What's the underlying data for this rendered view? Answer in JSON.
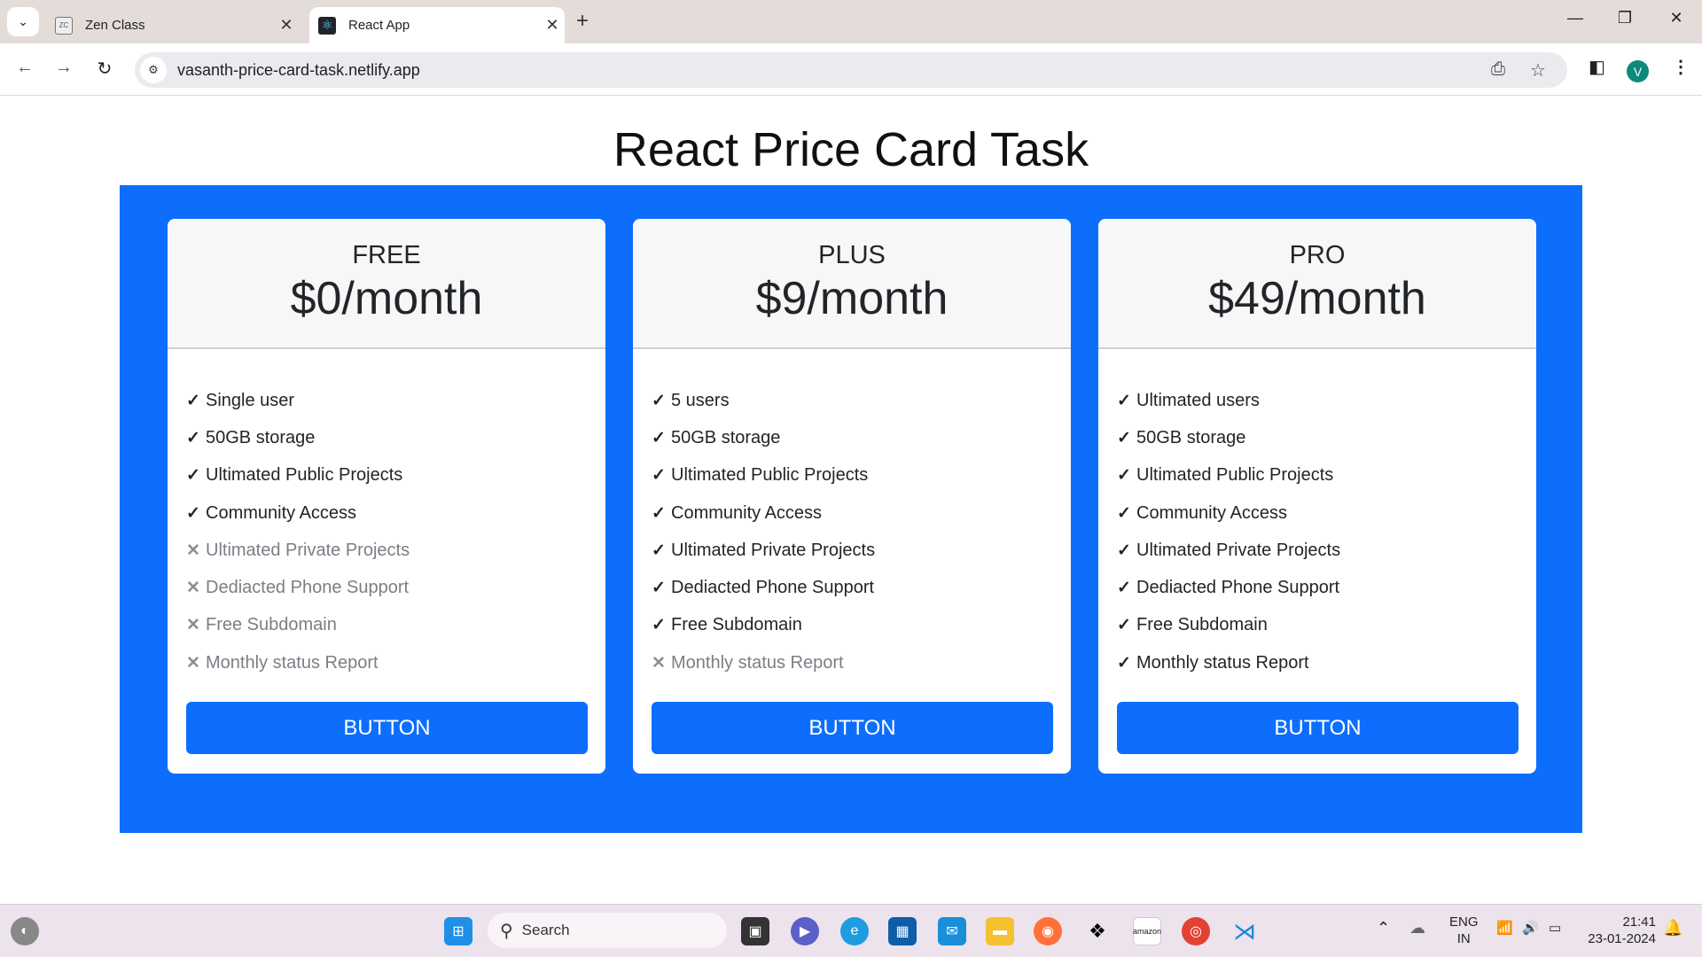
{
  "browser": {
    "tabs": [
      {
        "title": "Zen Class",
        "favicon": "zen-class-icon",
        "active": false
      },
      {
        "title": "React App",
        "favicon": "react-icon",
        "active": true
      }
    ],
    "url": "vasanth-price-card-task.netlify.app",
    "profile_initial": "V"
  },
  "page": {
    "title": "React Price Card Task",
    "accent_color": "#0d6efd",
    "cards": [
      {
        "plan": "FREE",
        "price": "$0/month",
        "button": "BUTTON",
        "features": [
          {
            "text": "Single user",
            "included": true
          },
          {
            "text": "50GB storage",
            "included": true
          },
          {
            "text": "Ultimated Public Projects",
            "included": true
          },
          {
            "text": "Community Access",
            "included": true
          },
          {
            "text": "Ultimated Private Projects",
            "included": false
          },
          {
            "text": "Dediacted Phone Support",
            "included": false
          },
          {
            "text": "Free Subdomain",
            "included": false
          },
          {
            "text": "Monthly status Report",
            "included": false
          }
        ]
      },
      {
        "plan": "PLUS",
        "price": "$9/month",
        "button": "BUTTON",
        "features": [
          {
            "text": "5 users",
            "included": true
          },
          {
            "text": "50GB storage",
            "included": true
          },
          {
            "text": "Ultimated Public Projects",
            "included": true
          },
          {
            "text": "Community Access",
            "included": true
          },
          {
            "text": "Ultimated Private Projects",
            "included": true
          },
          {
            "text": "Dediacted Phone Support",
            "included": true
          },
          {
            "text": "Free Subdomain",
            "included": true
          },
          {
            "text": "Monthly status Report",
            "included": false
          }
        ]
      },
      {
        "plan": "PRO",
        "price": "$49/month",
        "button": "BUTTON",
        "features": [
          {
            "text": "Ultimated users",
            "included": true
          },
          {
            "text": "50GB storage",
            "included": true
          },
          {
            "text": "Ultimated Public Projects",
            "included": true
          },
          {
            "text": "Community Access",
            "included": true
          },
          {
            "text": "Ultimated Private Projects",
            "included": true
          },
          {
            "text": "Dediacted Phone Support",
            "included": true
          },
          {
            "text": "Free Subdomain",
            "included": true
          },
          {
            "text": "Monthly status Report",
            "included": true
          }
        ]
      }
    ]
  },
  "taskbar": {
    "search_placeholder": "Search",
    "language": "ENG",
    "region": "IN",
    "time": "21:41",
    "date": "23-01-2024"
  }
}
